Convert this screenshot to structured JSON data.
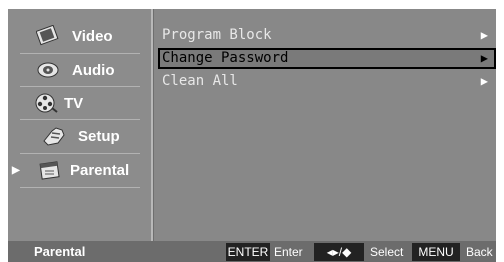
{
  "sidebar": {
    "items": [
      {
        "label": "Video",
        "icon": "video-film-icon"
      },
      {
        "label": "Audio",
        "icon": "audio-speaker-icon"
      },
      {
        "label": "TV",
        "icon": "tv-reel-icon"
      },
      {
        "label": "Setup",
        "icon": "setup-hand-icon"
      },
      {
        "label": "Parental",
        "icon": "parental-calendar-icon",
        "selected": true
      }
    ],
    "pointer": "▶"
  },
  "menu": {
    "items": [
      {
        "label": "Program Block",
        "arrow": "▶"
      },
      {
        "label": "Change Password",
        "arrow": "▶",
        "selected": true
      },
      {
        "label": "Clean All",
        "arrow": "▶"
      }
    ]
  },
  "footer": {
    "title": "Parental",
    "enter_key": "ENTER",
    "enter_label": "Enter",
    "select_key": "◂▸/◆",
    "select_label": "Select",
    "menu_key": "MENU",
    "back_label": "Back"
  },
  "colors": {
    "panel": "#888888",
    "footer": "#6c6c6c",
    "key_bg": "#222222",
    "selected_outline": "#000000"
  }
}
